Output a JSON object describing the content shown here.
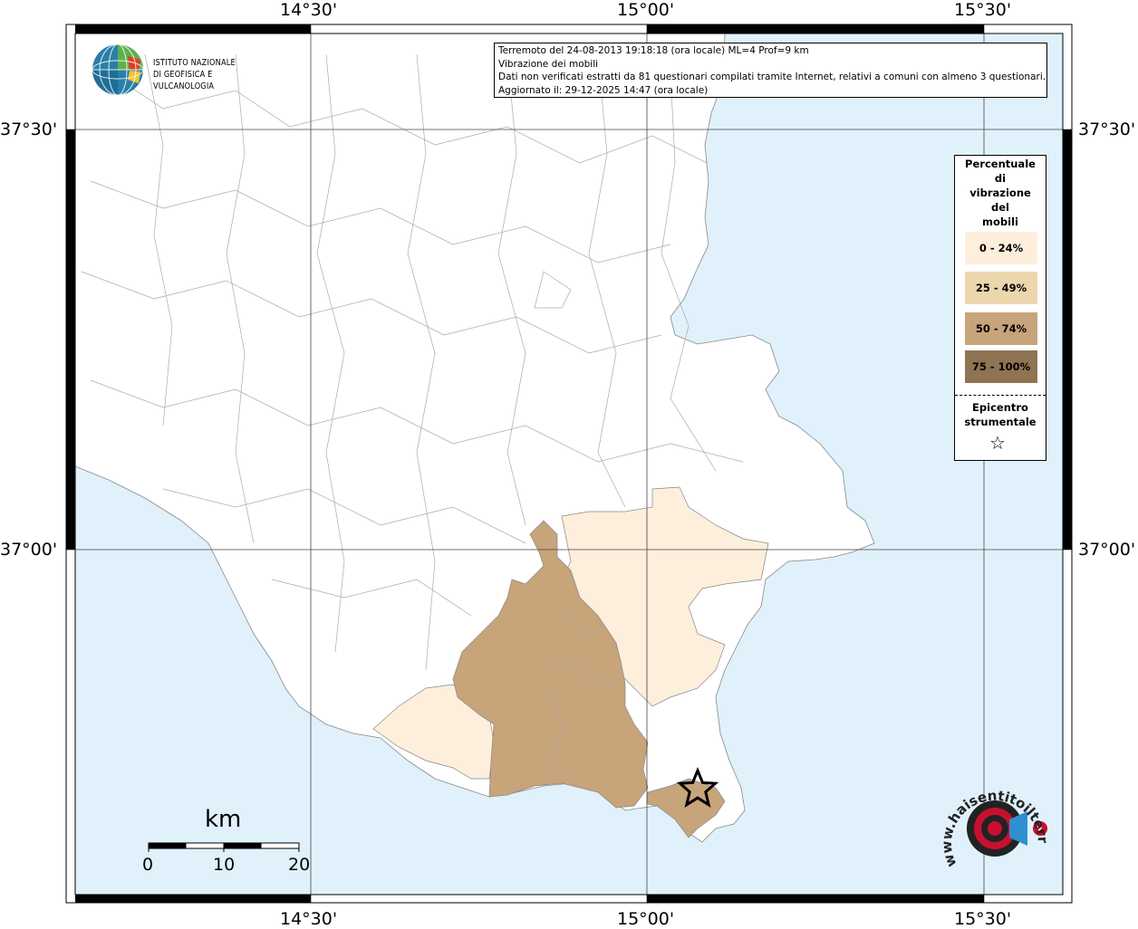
{
  "title_box": {
    "line1": "Terremoto del 24-08-2013 19:18:18 (ora locale) ML=4 Prof=9 km",
    "line2": "Vibrazione dei mobili",
    "line3": "Dati non verificati estratti da 81 questionari compilati tramite Internet, relativi a comuni con almeno 3 questionari.",
    "line4": "Aggiornato il: 29-12-2025 14:47 (ora locale)"
  },
  "logo": {
    "line1": "ISTITUTO NAZIONALE",
    "line2": "DI GEOFISICA E VULCANOLOGIA"
  },
  "axes": {
    "top_lon": [
      "14°30'",
      "15°00'",
      "15°30'"
    ],
    "bottom_lon": [
      "14°30'",
      "15°00'",
      "15°30'"
    ],
    "left_lat": [
      "37°30'",
      "37°00'"
    ],
    "right_lat": [
      "37°30'",
      "37°00'"
    ]
  },
  "legend": {
    "title": [
      "Percentuale",
      "di",
      "vibrazione",
      "del",
      "mobili"
    ],
    "classes": [
      {
        "label": "0 - 24%",
        "color": "#fdefdc"
      },
      {
        "label": "25 - 49%",
        "color": "#ecd6ae"
      },
      {
        "label": "50 - 74%",
        "color": "#c7a47a"
      },
      {
        "label": "75 - 100%",
        "color": "#8f7352"
      }
    ],
    "epicenter_title": [
      "Epicentro",
      "strumentale"
    ]
  },
  "scale_bar": {
    "unit": "km",
    "ticks": [
      "0",
      "10",
      "20"
    ]
  },
  "watermark": {
    "text": "www.haisentitoilterremoto.it"
  },
  "colors": {
    "sea": "#e0f1fb",
    "land": "#ffffff",
    "border": "#999999"
  }
}
